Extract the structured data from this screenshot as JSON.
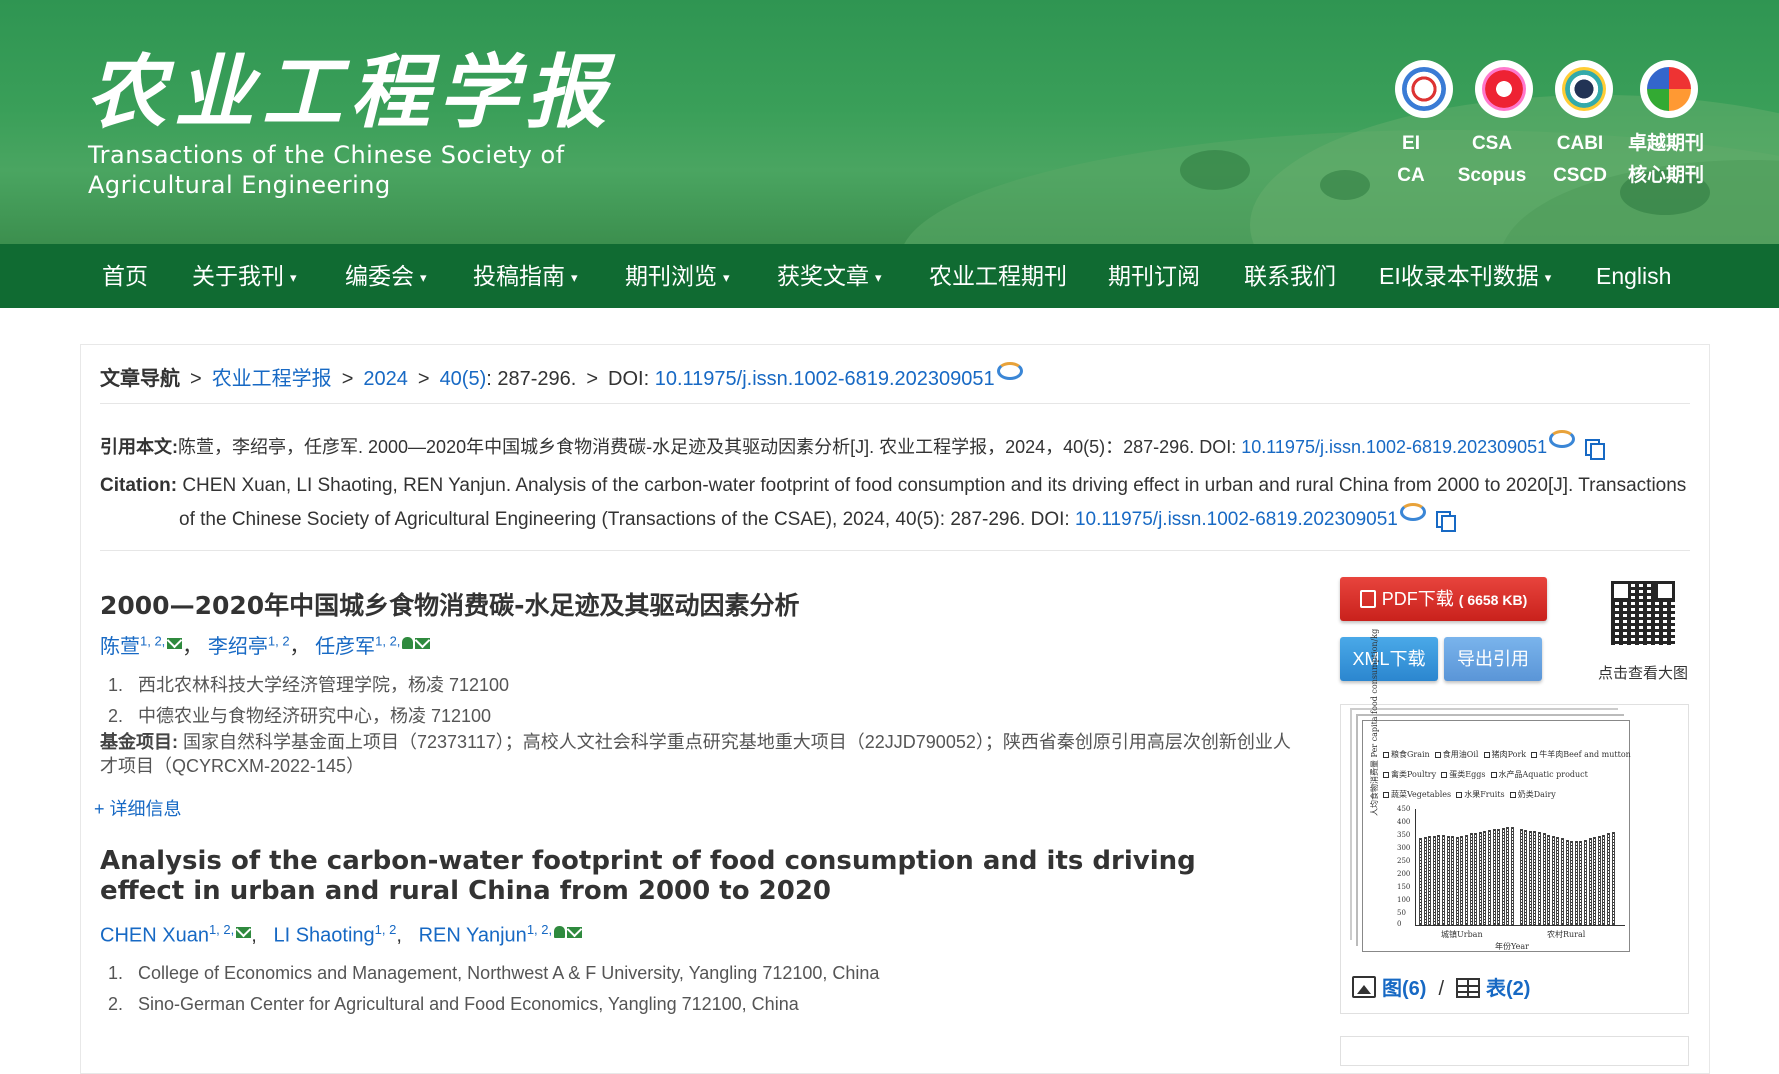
{
  "header": {
    "title_cn": "农业工程学报",
    "title_en_line1": "Transactions of the Chinese Society of",
    "title_en_line2": "Agricultural Engineering",
    "badges": [
      {
        "icon": "ei-logo-icon",
        "line1": "EI",
        "line2": "CA"
      },
      {
        "icon": "csa-logo-icon",
        "line1": "CSA",
        "line2": "Scopus"
      },
      {
        "icon": "cabi-logo-icon",
        "line1": "CABI",
        "line2": "CSCD"
      },
      {
        "icon": "zhuoyue-logo-icon",
        "line1": "卓越期刊",
        "line2": "核心期刊"
      }
    ]
  },
  "nav": {
    "items": [
      {
        "label": "首页",
        "dropdown": false
      },
      {
        "label": "关于我刊",
        "dropdown": true
      },
      {
        "label": "编委会",
        "dropdown": true
      },
      {
        "label": "投稿指南",
        "dropdown": true
      },
      {
        "label": "期刊浏览",
        "dropdown": true
      },
      {
        "label": "获奖文章",
        "dropdown": true
      },
      {
        "label": "农业工程期刊",
        "dropdown": false
      },
      {
        "label": "期刊订阅",
        "dropdown": false
      },
      {
        "label": "联系我们",
        "dropdown": false
      },
      {
        "label": "EI收录本刊数据",
        "dropdown": true
      },
      {
        "label": "English",
        "dropdown": false
      }
    ],
    "caret": "▾"
  },
  "breadcrumb": {
    "label": "文章导航",
    "sep": ">",
    "journal": "农业工程学报",
    "year": "2024",
    "issue": "40(5)",
    "pages": ": 287-296.",
    "doi_label": "DOI:",
    "doi": "10.11975/j.issn.1002-6819.202309051"
  },
  "citation": {
    "cn_label": "引用本文:",
    "cn_text": "陈萱，李绍亭，任彦军. 2000—2020年中国城乡食物消费碳-水足迹及其驱动因素分析[J]. 农业工程学报，2024，40(5)：287-296. DOI: ",
    "en_label": "Citation:",
    "en_text": "CHEN Xuan, LI Shaoting, REN Yanjun. Analysis of the carbon-water footprint of food consumption and its driving effect in urban and rural China from 2000 to 2020[J]. Transactions of the Chinese Society of Agricultural Engineering (Transactions of the CSAE), 2024, 40(5): 287-296. DOI: ",
    "doi": "10.11975/j.issn.1002-6819.202309051"
  },
  "article_cn": {
    "title": "2000—2020年中国城乡食物消费碳-水足迹及其驱动因素分析",
    "authors": [
      {
        "name": "陈萱",
        "sup": "1, 2,"
      },
      {
        "name": "李绍亭",
        "sup": "1, 2"
      },
      {
        "name": "任彦军",
        "sup": "1, 2,"
      }
    ],
    "affiliations": [
      {
        "n": "1.",
        "text": "西北农林科技大学经济管理学院，杨凌 712100"
      },
      {
        "n": "2.",
        "text": "中德农业与食物经济研究中心，杨凌 712100"
      }
    ],
    "fund_label": "基金项目:",
    "fund_text": "国家自然科学基金面上项目（72373117）；高校人文社会科学重点研究基地重大项目（22JJD790052）；陕西省秦创原引用高层次创新创业人才项目（QCYRCXM-2022-145）",
    "detail_link": "+ 详细信息"
  },
  "article_en": {
    "title": "Analysis of the carbon-water footprint of food consumption and its driving effect in urban and rural China from 2000 to 2020",
    "authors": [
      {
        "name": "CHEN Xuan",
        "sup": "1, 2,"
      },
      {
        "name": "LI Shaoting",
        "sup": "1, 2"
      },
      {
        "name": "REN Yanjun",
        "sup": "1, 2,"
      }
    ],
    "affiliations": [
      {
        "n": "1.",
        "text": "College of Economics and Management, Northwest A & F University, Yangling 712100, China"
      },
      {
        "n": "2.",
        "text": "Sino-German Center for Agricultural and Food Economics, Yangling 712100, China"
      }
    ]
  },
  "sidebar": {
    "pdf_label": "PDF下载",
    "pdf_size": "( 6658 KB)",
    "xml_label": "XML下载",
    "export_label": "导出引用",
    "qr_label": "点击查看大图",
    "figures_label": "图(6)",
    "tables_label": "表(2)",
    "slash": "/"
  },
  "thumbnail": {
    "legend": [
      "粮食Grain",
      "食用油Oil",
      "猪肉Pork",
      "牛羊肉Beef and mutton",
      "禽类Poultry",
      "蛋类Eggs",
      "水产品Aquatic product",
      "蔬菜Vegetables",
      "水果Fruits",
      "奶类Dairy"
    ],
    "yticks": [
      "450",
      "400",
      "350",
      "300",
      "250",
      "200",
      "150",
      "100",
      "50",
      "0"
    ],
    "ylabel": "人均食物消费量 Per capita food consumption/kg",
    "urban": "城镇Urban",
    "rural": "农村Rural",
    "xlabel": "年份Year"
  },
  "chart_data": {
    "type": "bar",
    "ylim": [
      0,
      450
    ],
    "series": [
      {
        "name": "城镇Urban",
        "values": [
          330,
          335,
          338,
          340,
          342,
          345,
          340,
          338,
          336,
          340,
          345,
          350,
          352,
          355,
          358,
          362,
          365,
          368,
          370,
          372,
          375
        ]
      },
      {
        "name": "农村Rural",
        "values": [
          365,
          362,
          360,
          358,
          355,
          350,
          345,
          340,
          335,
          330,
          325,
          322,
          320,
          322,
          325,
          330,
          335,
          340,
          345,
          350,
          355
        ]
      }
    ]
  }
}
